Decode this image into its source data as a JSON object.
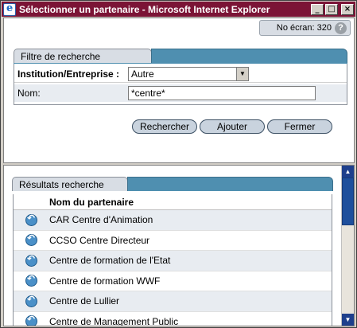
{
  "window": {
    "title": "Sélectionner un partenaire - Microsoft Internet Explorer",
    "minimize": "_",
    "maximize": "□",
    "close": "×"
  },
  "header": {
    "screen_number": "No écran: 320",
    "help": "?"
  },
  "filter": {
    "tab_label": "Filtre de recherche",
    "institution_label": "Institution/Entreprise :",
    "institution_value": "Autre",
    "name_label": "Nom:",
    "name_value": "*centre*"
  },
  "buttons": {
    "search": "Rechercher",
    "add": "Ajouter",
    "close": "Fermer"
  },
  "results": {
    "tab_label": "Résultats recherche",
    "column_header": "Nom du partenaire",
    "rows": [
      "CAR Centre d'Animation",
      "CCSO Centre Directeur",
      "Centre de formation de l'Etat",
      "Centre de formation WWF",
      "Centre de Lullier",
      "Centre de Management Public"
    ]
  },
  "scrollbar": {
    "up": "▲",
    "down": "▼"
  },
  "colors": {
    "titlebar": "#7b1436",
    "section_bar": "#4f8fb0",
    "scroll_thumb": "#1e4f9c"
  }
}
